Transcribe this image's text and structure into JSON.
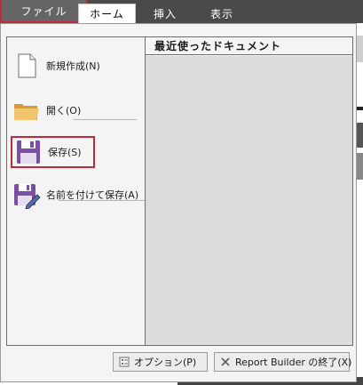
{
  "ribbon": {
    "tabs": {
      "file": "ファイル",
      "home": "ホーム",
      "insert": "挿入",
      "view": "表示"
    }
  },
  "backstage": {
    "menu": {
      "new": "新規作成(N)",
      "open": "開く(O)",
      "save": "保存(S)",
      "save_as": "名前を付けて保存(A)"
    },
    "recent_documents_title": "最近使ったドキュメント",
    "footer": {
      "options_label": "オプション(P)",
      "exit_label": "Report Builder の終了(X)"
    }
  },
  "icons": {
    "new": "new-document-icon",
    "open": "folder-icon",
    "save": "floppy-disk-icon",
    "save_as": "floppy-disk-pencil-icon",
    "options": "options-icon",
    "exit": "close-icon"
  },
  "colors": {
    "highlight_border": "#c0283c",
    "save_icon": "#7b4fa6",
    "folder_icon": "#e8b04a",
    "tab_bar": "#4a4a4a"
  }
}
